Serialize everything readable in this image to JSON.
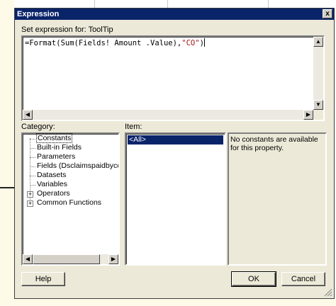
{
  "dialog": {
    "title": "Expression",
    "close_glyph": "x",
    "set_label": "Set expression for: ToolTip",
    "expression": {
      "prefix": "=Format(Sum(Fields! Amount .Value),",
      "string_literal": "\"CO\"",
      "suffix": ")"
    },
    "category": {
      "label": "Category:",
      "items": [
        {
          "label": "Constants",
          "selected": true,
          "expandable": false
        },
        {
          "label": "Built-in Fields",
          "expandable": false
        },
        {
          "label": "Parameters",
          "expandable": false
        },
        {
          "label": "Fields (Dsclaimspaidbyconditio",
          "expandable": false
        },
        {
          "label": "Datasets",
          "expandable": false
        },
        {
          "label": "Variables",
          "expandable": false
        },
        {
          "label": "Operators",
          "expandable": true
        },
        {
          "label": "Common Functions",
          "expandable": true
        }
      ],
      "expander_glyph": "+"
    },
    "item": {
      "label": "Item:",
      "selected_value": "<All>"
    },
    "description": "No constants are available for this property.",
    "buttons": {
      "help": "Help",
      "ok": "OK",
      "cancel": "Cancel"
    }
  },
  "scroll_glyphs": {
    "left": "◀",
    "right": "▶",
    "up": "▲",
    "down": "▼"
  },
  "colors": {
    "titlebar": "#0a246a",
    "dialog_face": "#ece9d8",
    "string_literal": "#a31515",
    "selection": "#0a246a"
  }
}
